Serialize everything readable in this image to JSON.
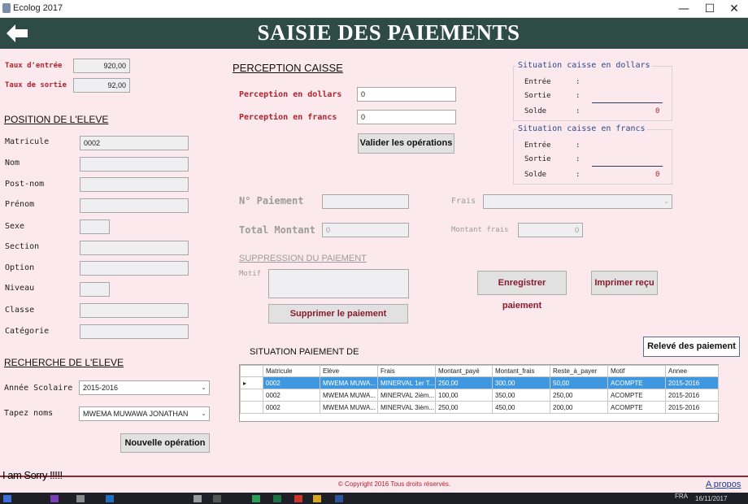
{
  "window": {
    "title": "Ecolog 2017",
    "minimize": "—",
    "maximize": "☐",
    "close": "✕"
  },
  "banner": {
    "title": "SAISIE DES PAIEMENTS"
  },
  "rates": {
    "entry_label": "Taux d'entrée",
    "entry_value": "920,00",
    "exit_label": "Taux de sortie",
    "exit_value": "92,00"
  },
  "position": {
    "title": "POSITION DE L'ELEVE",
    "fields": [
      {
        "label": "Matricule",
        "value": "0002"
      },
      {
        "label": "Nom",
        "value": ""
      },
      {
        "label": "Post-nom",
        "value": ""
      },
      {
        "label": "Prénom",
        "value": ""
      },
      {
        "label": "Sexe",
        "value": ""
      },
      {
        "label": "Section",
        "value": ""
      },
      {
        "label": "Option",
        "value": ""
      },
      {
        "label": "Niveau",
        "value": ""
      },
      {
        "label": "Classe",
        "value": ""
      },
      {
        "label": "Catégorie",
        "value": ""
      }
    ]
  },
  "search": {
    "title": "RECHERCHE DE L'ELEVE",
    "year_label": "Année Scolaire",
    "year_value": "2015-2016",
    "name_label": "Tapez noms",
    "name_value": "MWEMA MUWAWA JONATHAN",
    "new_button": "Nouvelle opération"
  },
  "perception": {
    "title": "PERCEPTION CAISSE",
    "dollars_label": "Perception en dollars",
    "dollars_value": "0",
    "francs_label": "Perception en francs",
    "francs_value": "0",
    "validate_button": "Valider les opérations"
  },
  "cash_dollars": {
    "title": "Situation caisse en dollars",
    "in_label": "Entrée",
    "out_label": "Sortie",
    "balance_label": "Solde",
    "colon": ":",
    "balance_value": "0"
  },
  "cash_francs": {
    "title": "Situation caisse en francs",
    "in_label": "Entrée",
    "out_label": "Sortie",
    "balance_label": "Solde",
    "colon": ":",
    "balance_value": "0"
  },
  "payment": {
    "number_label": "N° Paiement",
    "number_value": "",
    "fees_label": "Frais",
    "fees_value": "",
    "total_label": "Total Montant",
    "total_value": "0",
    "fee_amount_label": "Montant frais",
    "fee_amount_value": "0"
  },
  "deletion": {
    "title": "SUPPRESSION DU PAIEMENT",
    "reason_label": "Motif",
    "reason_value": "",
    "delete_button": "Supprimer le paiement"
  },
  "actions": {
    "save_button": "Enregistrer paiement",
    "print_button": "Imprimer reçu",
    "statement_button": "Relevé des paiement"
  },
  "situation": {
    "title": "SITUATION PAIEMENT DE",
    "columns": [
      "Matricule",
      "Elève",
      "Frais",
      "Montant_payé",
      "Montant_frais",
      "Reste_à_payer",
      "Motif",
      "Annee"
    ],
    "rows": [
      {
        "indicator": "▸",
        "cells": [
          "0002",
          "MWEMA MUWA...",
          "MINERVAL 1er T...",
          "250,00",
          "300,00",
          "50,00",
          "ACOMPTE",
          "2015-2016"
        ]
      },
      {
        "indicator": "",
        "cells": [
          "0002",
          "MWEMA MUWA...",
          "MINERVAL 2ièm...",
          "100,00",
          "350,00",
          "250,00",
          "ACOMPTE",
          "2015-2016"
        ]
      },
      {
        "indicator": "",
        "cells": [
          "0002",
          "MWEMA MUWA...",
          "MINERVAL 3ièm...",
          "250,00",
          "450,00",
          "200,00",
          "ACOMPTE",
          "2015-2016"
        ]
      }
    ]
  },
  "footer": {
    "overlay_text": "I am Sorry !!!!!",
    "copyright": "© Copyright 2016 Tous droits réservés.",
    "about_link": "A propos"
  },
  "taskbar": {
    "lang": "FRA",
    "date": "16/11/2017"
  },
  "colors": {
    "banner": "#2f4b46",
    "background": "#fbe9ee",
    "label_red": "#b3222c",
    "selected_row": "#3f98df"
  }
}
